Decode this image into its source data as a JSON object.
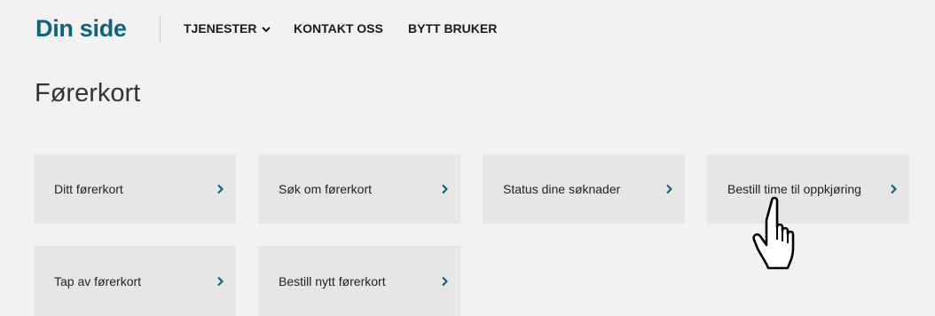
{
  "header": {
    "brand": "Din side",
    "nav": [
      {
        "label": "TJENESTER",
        "has_dropdown": true
      },
      {
        "label": "KONTAKT OSS",
        "has_dropdown": false
      },
      {
        "label": "BYTT BRUKER",
        "has_dropdown": false
      }
    ]
  },
  "main": {
    "title": "Førerkort",
    "tiles": [
      {
        "label": "Ditt førerkort"
      },
      {
        "label": "Søk om førerkort"
      },
      {
        "label": "Status dine søknader"
      },
      {
        "label": "Bestill time til oppkjøring"
      },
      {
        "label": "Tap av førerkort"
      },
      {
        "label": "Bestill nytt førerkort"
      }
    ]
  },
  "colors": {
    "brand": "#0b6582",
    "page_background": "#f2f2f2",
    "tile_background": "#e6e6e6",
    "arrow": "#0b6582"
  },
  "icons": {
    "nav_dropdown": "chevron-down-icon",
    "tile_arrow": "chevron-right-icon",
    "cursor": "hand-pointer-cursor-icon"
  }
}
